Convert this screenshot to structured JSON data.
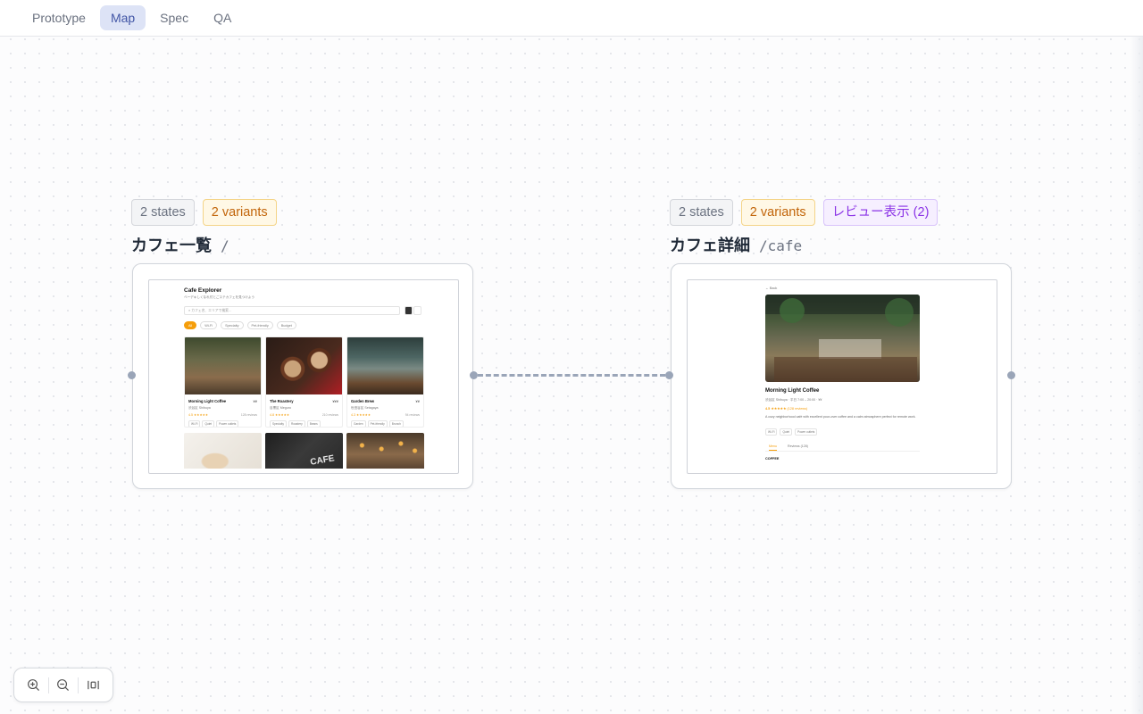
{
  "tabs": [
    {
      "label": "Prototype",
      "active": false
    },
    {
      "label": "Map",
      "active": true
    },
    {
      "label": "Spec",
      "active": false
    },
    {
      "label": "QA",
      "active": false
    }
  ],
  "screens": [
    {
      "name": "カフェ一覧",
      "route": "/",
      "badges": {
        "states": "2 states",
        "variants": "2 variants"
      },
      "preview": {
        "title": "Cafe Explorer",
        "subtitle": "ベーデキしくなれ付とごステカフェを見つけよう",
        "search_placeholder": "カフェ名、エリアで検索...",
        "filters": [
          "All",
          "Wi-Fi",
          "Specialty",
          "Pet-friendly",
          "Budget"
        ],
        "cafes": [
          {
            "name": "Morning Light Coffee",
            "price": "¥¥",
            "area": "渋谷区 Shibuya",
            "rating": "4.5 ★★★★★",
            "reviews": "128 reviews",
            "tags": [
              "Wi-Fi",
              "Quiet",
              "Power outlets"
            ]
          },
          {
            "name": "The Roastery",
            "price": "¥¥¥",
            "area": "目黒区 Meguro",
            "rating": "4.8 ★★★★★",
            "reviews": "210 reviews",
            "tags": [
              "Specialty",
              "Roastery",
              "Beans"
            ]
          },
          {
            "name": "Garden Brew",
            "price": "¥¥",
            "area": "世田谷区 Setagaya",
            "rating": "4.3 ★★★★★",
            "reviews": "94 reviews",
            "tags": [
              "Garden",
              "Pet-friendly",
              "Brunch"
            ]
          }
        ]
      }
    },
    {
      "name": "カフェ詳細",
      "route": "/cafe",
      "badges": {
        "states": "2 states",
        "variants": "2 variants",
        "reviews": "レビュー表示 (2)"
      },
      "preview": {
        "back": "← Back",
        "name": "Morning Light Coffee",
        "meta": "渋谷区 Shibuya · 平日 7:00 – 20:00 · ¥¥",
        "rating": "4.5",
        "stars": "★★★★★ (128 reviews)",
        "description": "A cozy neighborhood café with excellent pour-over coffee and a calm atmosphere perfect for remote work.",
        "tags": [
          "Wi-Fi",
          "Quiet",
          "Power outlets"
        ],
        "tabs": [
          "Menu",
          "Reviews (128)"
        ],
        "section": "COFFEE"
      }
    }
  ],
  "zoom": {
    "in_icon": "zoom-in-icon",
    "out_icon": "zoom-out-icon",
    "fit_icon": "fit-view-icon"
  },
  "colors": {
    "accent": "#4256a6",
    "connector": "#9aa5b8",
    "amber": "#c2650a",
    "purple": "#8b33e6",
    "orange": "#f59e0b"
  }
}
